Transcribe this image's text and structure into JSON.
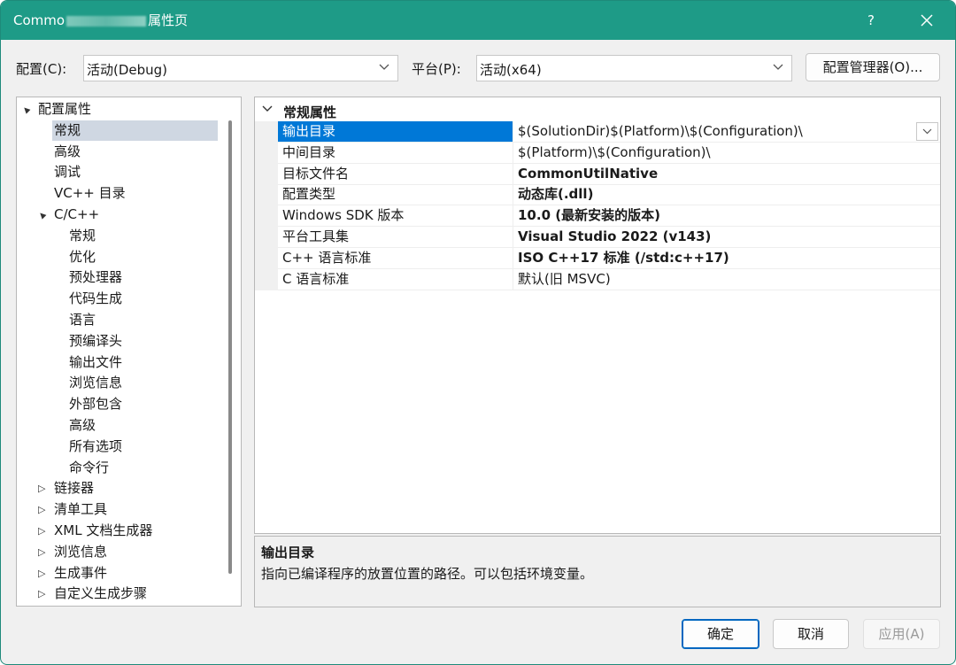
{
  "window": {
    "title_prefix": "Commo",
    "title_suffix": "属性页",
    "help_label": "?",
    "close_icon": "close-icon"
  },
  "toolbar": {
    "config_label": "配置(C):",
    "config_value": "活动(Debug)",
    "platform_label": "平台(P):",
    "platform_value": "活动(x64)",
    "manager_button": "配置管理器(O)..."
  },
  "tree": {
    "items": [
      {
        "label": "配置属性",
        "expander": "▲"
      },
      {
        "label": "常规",
        "selected": true
      },
      {
        "label": "高级"
      },
      {
        "label": "调试"
      },
      {
        "label": "VC++ 目录"
      },
      {
        "label": "C/C++",
        "expander": "▲"
      },
      {
        "label": "常规"
      },
      {
        "label": "优化"
      },
      {
        "label": "预处理器"
      },
      {
        "label": "代码生成"
      },
      {
        "label": "语言"
      },
      {
        "label": "预编译头"
      },
      {
        "label": "输出文件"
      },
      {
        "label": "浏览信息"
      },
      {
        "label": "外部包含"
      },
      {
        "label": "高级"
      },
      {
        "label": "所有选项"
      },
      {
        "label": "命令行"
      },
      {
        "label": "链接器",
        "expander": "▷"
      },
      {
        "label": "清单工具",
        "expander": "▷"
      },
      {
        "label": "XML 文档生成器",
        "expander": "▷"
      },
      {
        "label": "浏览信息",
        "expander": "▷"
      },
      {
        "label": "生成事件",
        "expander": "▷"
      },
      {
        "label": "自定义生成步骤",
        "expander": "▷"
      }
    ]
  },
  "grid": {
    "section_title": "常规属性",
    "rows": [
      {
        "name": "输出目录",
        "value": "$(SolutionDir)$(Platform)\\$(Configuration)\\",
        "bold": false
      },
      {
        "name": "中间目录",
        "value": "$(Platform)\\$(Configuration)\\",
        "bold": false
      },
      {
        "name": "目标文件名",
        "value": "CommonUtilNative",
        "bold": true
      },
      {
        "name": "配置类型",
        "value": "动态库(.dll)",
        "bold": true
      },
      {
        "name": "Windows SDK 版本",
        "value": "10.0 (最新安装的版本)",
        "bold": true
      },
      {
        "name": "平台工具集",
        "value": "Visual Studio 2022 (v143)",
        "bold": true
      },
      {
        "name": "C++ 语言标准",
        "value": "ISO C++17 标准 (/std:c++17)",
        "bold": true
      },
      {
        "name": "C 语言标准",
        "value": "默认(旧 MSVC)",
        "bold": false
      }
    ]
  },
  "description": {
    "title": "输出目录",
    "text": "指向已编译程序的放置位置的路径。可以包括环境变量。"
  },
  "buttons": {
    "ok": "确定",
    "cancel": "取消",
    "apply": "应用(A)"
  },
  "colors": {
    "titlebar": "#1e9b87",
    "selection": "#0078d7",
    "tree_selection": "#cfd7e2"
  }
}
